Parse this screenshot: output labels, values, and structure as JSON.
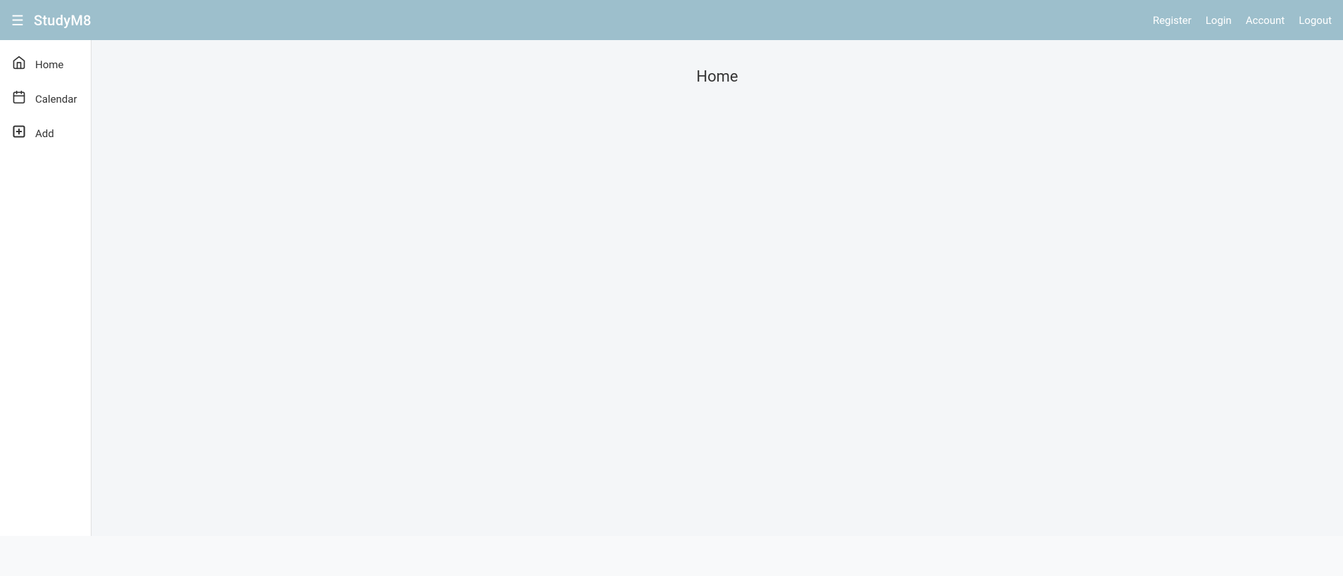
{
  "navbar": {
    "brand": "StudyM8",
    "menu_icon": "☰",
    "links": [
      {
        "id": "register",
        "label": "Register"
      },
      {
        "id": "login",
        "label": "Login"
      },
      {
        "id": "account",
        "label": "Account"
      },
      {
        "id": "logout",
        "label": "Logout"
      }
    ]
  },
  "sidebar": {
    "items": [
      {
        "id": "home",
        "label": "Home",
        "icon": "home"
      },
      {
        "id": "calendar",
        "label": "Calendar",
        "icon": "calendar"
      },
      {
        "id": "add",
        "label": "Add",
        "icon": "add"
      }
    ]
  },
  "main": {
    "title": "Home"
  },
  "colors": {
    "navbar_bg": "#9dbfcc",
    "sidebar_bg": "#ffffff",
    "main_bg": "#f4f6f8"
  }
}
